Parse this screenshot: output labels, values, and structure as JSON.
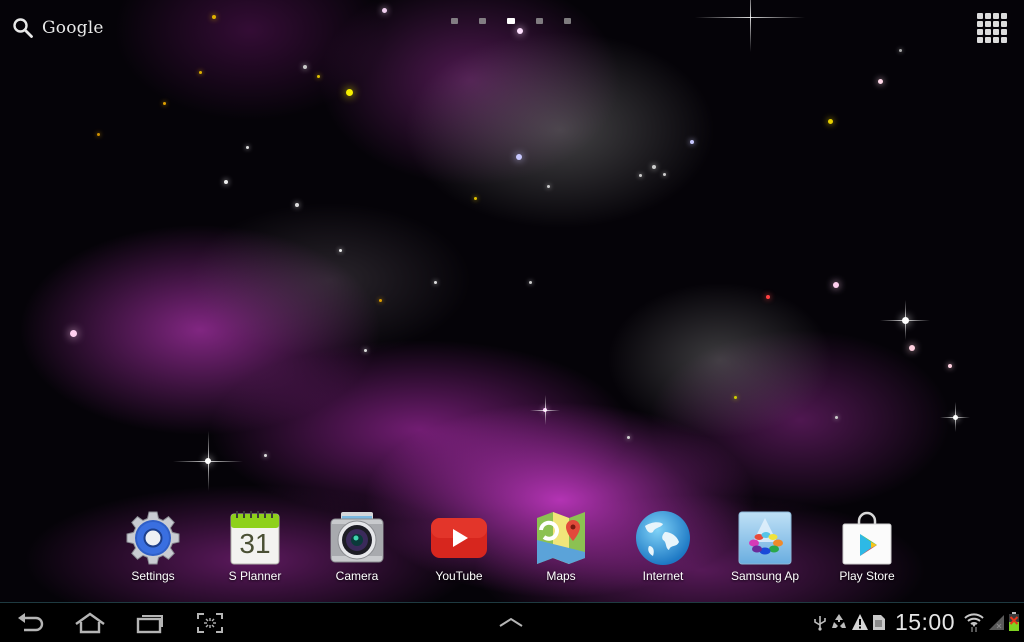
{
  "search": {
    "label": "Google",
    "icon": "search-icon"
  },
  "home_pages": {
    "count": 5,
    "active_index": 2
  },
  "apps_drawer": {
    "icon": "apps-grid-icon"
  },
  "dock": {
    "apps": [
      {
        "label": "Settings",
        "icon": "settings-gear-icon"
      },
      {
        "label": "S Planner",
        "icon": "calendar-icon",
        "icon_text": "31"
      },
      {
        "label": "Camera",
        "icon": "camera-icon"
      },
      {
        "label": "YouTube",
        "icon": "youtube-icon"
      },
      {
        "label": "Maps",
        "icon": "maps-icon"
      },
      {
        "label": "Internet",
        "icon": "globe-icon"
      },
      {
        "label": "Samsung Ap",
        "icon": "samsung-apps-icon"
      },
      {
        "label": "Play Store",
        "icon": "play-store-icon"
      }
    ]
  },
  "navbar": {
    "buttons": [
      "back-icon",
      "home-icon",
      "recent-apps-icon",
      "screenshot-icon"
    ],
    "up_arrow": "chevron-up-icon"
  },
  "status": {
    "icons": [
      "usb-icon",
      "recycle-icon",
      "warning-icon",
      "sd-card-icon"
    ],
    "time": "15:00",
    "right_icons": [
      "wifi-icon",
      "signal-icon",
      "battery-icon"
    ]
  },
  "colors": {
    "nav_border": "#1e3a40",
    "text": "#ffffff",
    "clock": "#e6e6e6"
  }
}
